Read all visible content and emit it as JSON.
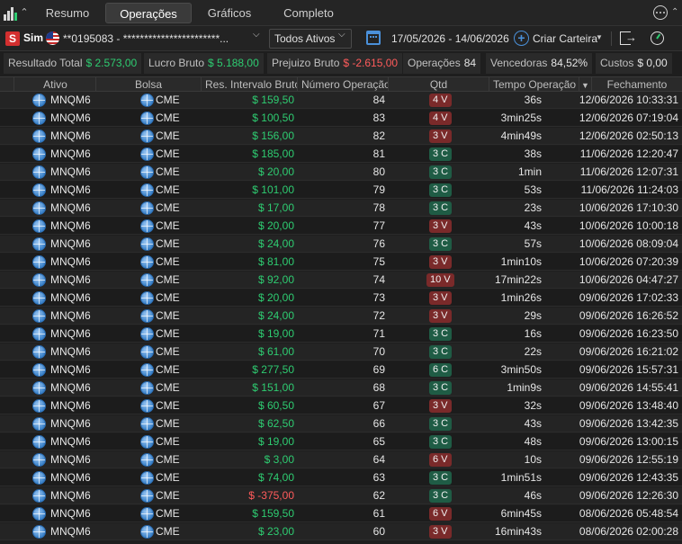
{
  "tabs": [
    {
      "label": "Resumo",
      "active": false
    },
    {
      "label": "Operações",
      "active": true
    },
    {
      "label": "Gráficos",
      "active": false
    },
    {
      "label": "Completo",
      "active": false
    }
  ],
  "toolbar": {
    "sim_badge": "S",
    "sim_label": "Sim",
    "account_text": "**0195083 - ***********************...",
    "assets_filter": "Todos Ativos",
    "period": "17/05/2026 - 14/06/2026",
    "create_wallet": "Criar Carteira"
  },
  "stats": [
    {
      "label": "Resultado Total",
      "value": "$ 2.573,00",
      "tone": "pos"
    },
    {
      "label": "Lucro Bruto",
      "value": "$ 5.188,00",
      "tone": "pos"
    },
    {
      "label": "Prejuizo Bruto",
      "value": "$ -2.615,00",
      "tone": "neg"
    },
    {
      "label": "Operações",
      "value": "84",
      "tone": "neutral"
    },
    {
      "label": "Vencedoras",
      "value": "84,52%",
      "tone": "neutral"
    },
    {
      "label": "Custos",
      "value": "$ 0,00",
      "tone": "neutral"
    }
  ],
  "table": {
    "headers": [
      "Ativo",
      "Bolsa",
      "Res. Intervalo Bruto",
      "Número Operação",
      "Qtd",
      "Tempo Operação",
      "Fechamento"
    ],
    "rows": [
      {
        "ativo": "MNQM6",
        "bolsa": "CME",
        "res": "$ 159,50",
        "num": "84",
        "qtd": "4 V",
        "tempo": "36s",
        "fech": "12/06/2026 10:33:31"
      },
      {
        "ativo": "MNQM6",
        "bolsa": "CME",
        "res": "$ 100,50",
        "num": "83",
        "qtd": "4 V",
        "tempo": "3min25s",
        "fech": "12/06/2026 07:19:04"
      },
      {
        "ativo": "MNQM6",
        "bolsa": "CME",
        "res": "$ 156,00",
        "num": "82",
        "qtd": "3 V",
        "tempo": "4min49s",
        "fech": "12/06/2026 02:50:13"
      },
      {
        "ativo": "MNQM6",
        "bolsa": "CME",
        "res": "$ 185,00",
        "num": "81",
        "qtd": "3 C",
        "tempo": "38s",
        "fech": "11/06/2026 12:20:47"
      },
      {
        "ativo": "MNQM6",
        "bolsa": "CME",
        "res": "$ 20,00",
        "num": "80",
        "qtd": "3 C",
        "tempo": "1min",
        "fech": "11/06/2026 12:07:31"
      },
      {
        "ativo": "MNQM6",
        "bolsa": "CME",
        "res": "$ 101,00",
        "num": "79",
        "qtd": "3 C",
        "tempo": "53s",
        "fech": "11/06/2026 11:24:03"
      },
      {
        "ativo": "MNQM6",
        "bolsa": "CME",
        "res": "$ 17,00",
        "num": "78",
        "qtd": "3 C",
        "tempo": "23s",
        "fech": "10/06/2026 17:10:30"
      },
      {
        "ativo": "MNQM6",
        "bolsa": "CME",
        "res": "$ 20,00",
        "num": "77",
        "qtd": "3 V",
        "tempo": "43s",
        "fech": "10/06/2026 10:00:18"
      },
      {
        "ativo": "MNQM6",
        "bolsa": "CME",
        "res": "$ 24,00",
        "num": "76",
        "qtd": "3 C",
        "tempo": "57s",
        "fech": "10/06/2026 08:09:04"
      },
      {
        "ativo": "MNQM6",
        "bolsa": "CME",
        "res": "$ 81,00",
        "num": "75",
        "qtd": "3 V",
        "tempo": "1min10s",
        "fech": "10/06/2026 07:20:39"
      },
      {
        "ativo": "MNQM6",
        "bolsa": "CME",
        "res": "$ 92,00",
        "num": "74",
        "qtd": "10 V",
        "tempo": "17min22s",
        "fech": "10/06/2026 04:47:27"
      },
      {
        "ativo": "MNQM6",
        "bolsa": "CME",
        "res": "$ 20,00",
        "num": "73",
        "qtd": "3 V",
        "tempo": "1min26s",
        "fech": "09/06/2026 17:02:33"
      },
      {
        "ativo": "MNQM6",
        "bolsa": "CME",
        "res": "$ 24,00",
        "num": "72",
        "qtd": "3 V",
        "tempo": "29s",
        "fech": "09/06/2026 16:26:52"
      },
      {
        "ativo": "MNQM6",
        "bolsa": "CME",
        "res": "$ 19,00",
        "num": "71",
        "qtd": "3 C",
        "tempo": "16s",
        "fech": "09/06/2026 16:23:50"
      },
      {
        "ativo": "MNQM6",
        "bolsa": "CME",
        "res": "$ 61,00",
        "num": "70",
        "qtd": "3 C",
        "tempo": "22s",
        "fech": "09/06/2026 16:21:02"
      },
      {
        "ativo": "MNQM6",
        "bolsa": "CME",
        "res": "$ 277,50",
        "num": "69",
        "qtd": "6 C",
        "tempo": "3min50s",
        "fech": "09/06/2026 15:57:31"
      },
      {
        "ativo": "MNQM6",
        "bolsa": "CME",
        "res": "$ 151,00",
        "num": "68",
        "qtd": "3 C",
        "tempo": "1min9s",
        "fech": "09/06/2026 14:55:41"
      },
      {
        "ativo": "MNQM6",
        "bolsa": "CME",
        "res": "$ 60,50",
        "num": "67",
        "qtd": "3 V",
        "tempo": "32s",
        "fech": "09/06/2026 13:48:40"
      },
      {
        "ativo": "MNQM6",
        "bolsa": "CME",
        "res": "$ 62,50",
        "num": "66",
        "qtd": "3 C",
        "tempo": "43s",
        "fech": "09/06/2026 13:42:35"
      },
      {
        "ativo": "MNQM6",
        "bolsa": "CME",
        "res": "$ 19,00",
        "num": "65",
        "qtd": "3 C",
        "tempo": "48s",
        "fech": "09/06/2026 13:00:15"
      },
      {
        "ativo": "MNQM6",
        "bolsa": "CME",
        "res": "$ 3,00",
        "num": "64",
        "qtd": "6 V",
        "tempo": "10s",
        "fech": "09/06/2026 12:55:19"
      },
      {
        "ativo": "MNQM6",
        "bolsa": "CME",
        "res": "$ 74,00",
        "num": "63",
        "qtd": "3 C",
        "tempo": "1min51s",
        "fech": "09/06/2026 12:43:35"
      },
      {
        "ativo": "MNQM6",
        "bolsa": "CME",
        "res": "$ -375,00",
        "num": "62",
        "qtd": "3 C",
        "tempo": "46s",
        "fech": "09/06/2026 12:26:30"
      },
      {
        "ativo": "MNQM6",
        "bolsa": "CME",
        "res": "$ 159,50",
        "num": "61",
        "qtd": "6 V",
        "tempo": "6min45s",
        "fech": "08/06/2026 05:48:54"
      },
      {
        "ativo": "MNQM6",
        "bolsa": "CME",
        "res": "$ 23,00",
        "num": "60",
        "qtd": "3 V",
        "tempo": "16min43s",
        "fech": "08/06/2026 02:00:28"
      }
    ]
  },
  "colors": {
    "positive": "#2ecc71",
    "negative": "#ff5b5b",
    "sell_badge": "#7a2a2a",
    "buy_badge": "#1f5c45",
    "accent": "#4a90d9"
  },
  "icons": [
    "bar-chart-icon",
    "chevron-up-icon",
    "us-flag-icon",
    "calendar-icon",
    "plus-circle-icon",
    "exit-icon",
    "timer-icon",
    "more-icon",
    "globe-icon",
    "sort-desc-icon"
  ]
}
